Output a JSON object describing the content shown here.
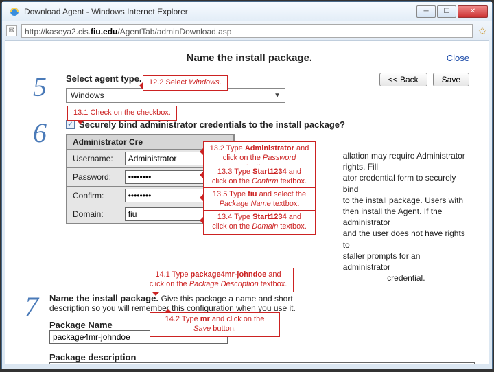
{
  "window": {
    "title": "Download Agent - Windows Internet Explorer",
    "url_prefix": "http://kaseya2.cis.",
    "url_host": "fiu.edu",
    "url_path": "/AgentTab/adminDownload.asp"
  },
  "header": {
    "title": "Name the install package.",
    "close": "Close"
  },
  "buttons": {
    "back": "<< Back",
    "save": "Save"
  },
  "step5": {
    "num": "5",
    "label": "Select agent type.",
    "select_value": "Windows"
  },
  "step6": {
    "num": "6",
    "checkbox_label": "Securely bind administrator credentials to the install package?",
    "table_header": "Administrator Cre",
    "row_user_label": "Username:",
    "row_user_value": "Administrator",
    "row_pass_label": "Password:",
    "row_pass_value": "••••••••",
    "row_conf_label": "Confirm:",
    "row_conf_value": "••••••••",
    "row_dom_label": "Domain:",
    "row_dom_value": "fiu",
    "desc_1": "allation may require Administrator rights. Fill",
    "desc_2": "ator credential form to securely bind",
    "desc_3": "to the install package. Users with",
    "desc_4": "then install the Agent. If the administrator",
    "desc_5": "and the user does not have rights to",
    "desc_6": "staller prompts for an administrator",
    "desc_7": "credential."
  },
  "step7": {
    "num": "7",
    "lead_bold": "Name the install package.",
    "lead_rest_1": " Give this package a name and short",
    "lead_rest_2": "description so you will remember this configuration when you use it.",
    "pkg_name_label": "Package Name",
    "pkg_name_value": "package4mr-johndoe",
    "pkg_desc_label": "Package description",
    "pkg_desc_value": ""
  },
  "callouts": {
    "c122": "12.2 Select <i>Windows</i>.",
    "c131": "13.1 Check on the checkbox.",
    "c132": "13.2 Type <b>Administrator</b> and click on the <i>Password</i> textbox.",
    "c133": "13.3 Type <b>Start1234</b> and click on the <i>Confirm</i> textbox.",
    "c135": "13.5 Type <b>fiu</b> and select the <i>Package Name</i> textbox.",
    "c134": "13.4 Type <b>Start1234</b> and click on the <i>Domain</i> textbox.",
    "c141": "14.1 Type <b>package4mr-johndoe</b> and click on the <i>Package Description</i> textbox.",
    "c142": "14.2 Type <b>mr</b> and click on the <i>Save</i> button."
  }
}
